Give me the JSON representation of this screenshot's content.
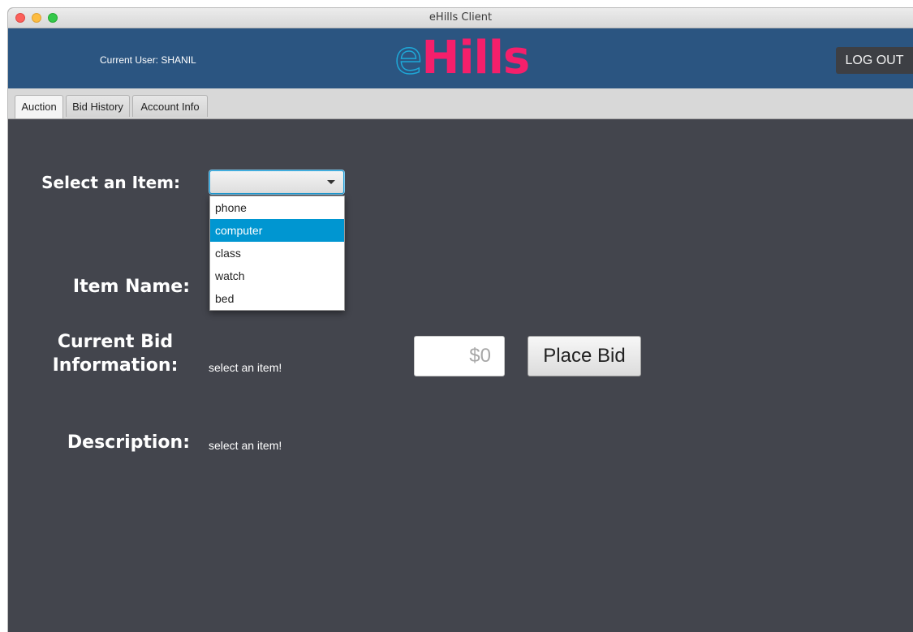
{
  "window": {
    "title": "eHills Client"
  },
  "header": {
    "current_user": "Current User: SHANIL",
    "logo_e": "e",
    "logo_rest": "Hills",
    "logout_label": "LOG OUT"
  },
  "tabs": [
    {
      "label": "Auction",
      "active": true
    },
    {
      "label": "Bid History",
      "active": false
    },
    {
      "label": "Account Info",
      "active": false
    }
  ],
  "auction": {
    "select_label": "Select an Item:",
    "selected_value": "",
    "options": [
      "phone",
      "computer",
      "class",
      "watch",
      "bed"
    ],
    "highlighted_option": "computer",
    "item_name_label": "Item Name:",
    "current_bid_label_line1": "Current Bid",
    "current_bid_label_line2": "Information:",
    "current_bid_value": "select an item!",
    "bid_placeholder": "$0",
    "place_bid_label": "Place Bid",
    "description_label": "Description:",
    "description_value": "select an item!"
  },
  "colors": {
    "header_bg": "#2b5581",
    "body_bg": "#43454d",
    "logo_pink": "#f51f6b",
    "logo_blue_outline": "#1ea8d8",
    "selection_blue": "#0096d1"
  }
}
